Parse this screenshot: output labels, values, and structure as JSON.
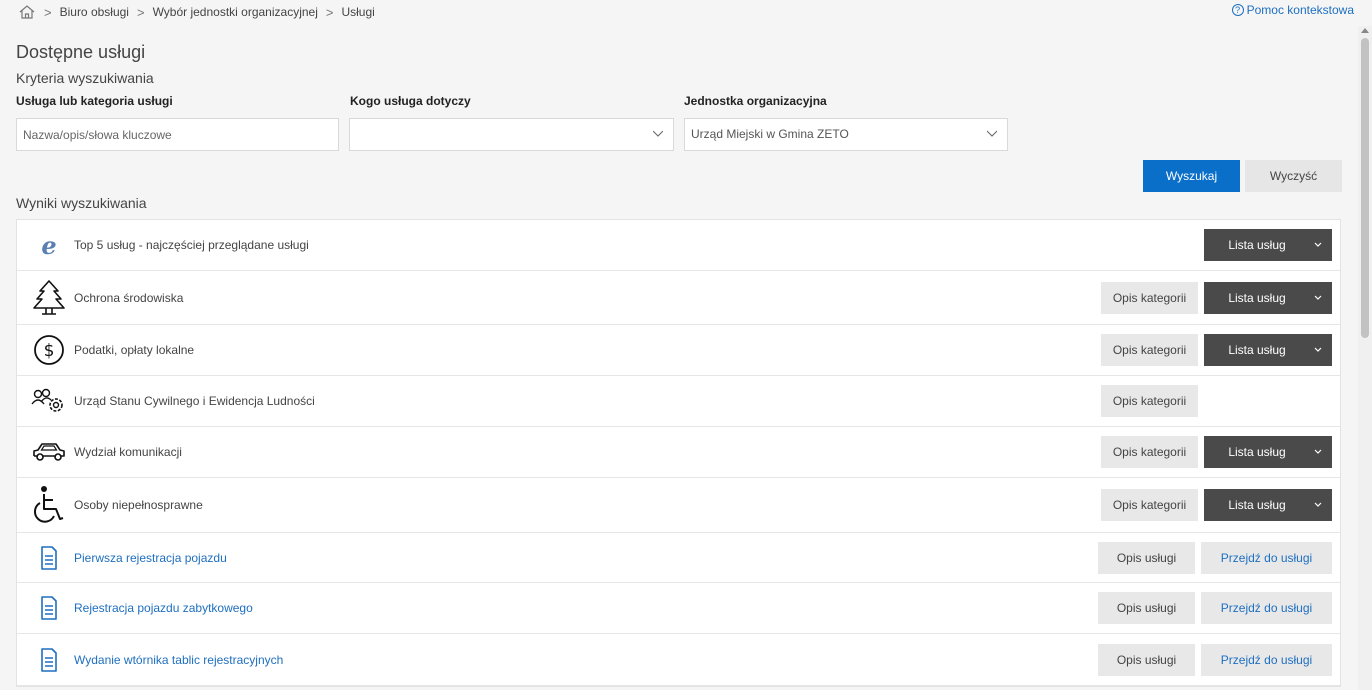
{
  "breadcrumb": {
    "items": [
      "Biuro obsługi",
      "Wybór jednostki organizacyjnej",
      "Usługi"
    ]
  },
  "help": {
    "label": "Pomoc kontekstowa"
  },
  "page": {
    "title": "Dostępne usługi",
    "criteria_title": "Kryteria wyszukiwania",
    "results_title": "Wyniki wyszukiwania"
  },
  "search": {
    "service_label": "Usługa lub kategoria usługi",
    "service_placeholder": "Nazwa/opis/słowa kluczowe",
    "who_label": "Kogo usługa dotyczy",
    "who_value": "",
    "unit_label": "Jednostka organizacyjna",
    "unit_value": "Urząd Miejski w Gmina ZETO",
    "search_button": "Wyszukaj",
    "clear_button": "Wyczyść"
  },
  "buttons": {
    "category_desc": "Opis kategorii",
    "service_list": "Lista usług",
    "service_desc": "Opis usługi",
    "go_to_service": "Przejdź do usługi"
  },
  "results": [
    {
      "label": "Top 5 usług - najczęściej przeglądane usługi",
      "icon": "e-letter-icon"
    },
    {
      "label": "Ochrona środowiska",
      "icon": "tree-icon"
    },
    {
      "label": "Podatki, opłaty lokalne",
      "icon": "dollar-circle-icon"
    },
    {
      "label": "Urząd Stanu Cywilnego i Ewidencja Ludności",
      "icon": "people-gear-icon"
    },
    {
      "label": "Wydział komunikacji",
      "icon": "car-icon"
    },
    {
      "label": "Osoby niepełnosprawne",
      "icon": "wheelchair-icon"
    },
    {
      "label": "Pierwsza rejestracja pojazdu",
      "icon": "document-icon"
    },
    {
      "label": "Rejestracja pojazdu zabytkowego",
      "icon": "document-icon"
    },
    {
      "label": "Wydanie wtórnika tablic rejestracyjnych",
      "icon": "document-icon"
    }
  ],
  "colors": {
    "accent": "#0a6fc9",
    "link": "#1e6fc0",
    "dark_button": "#4a4a4a"
  }
}
